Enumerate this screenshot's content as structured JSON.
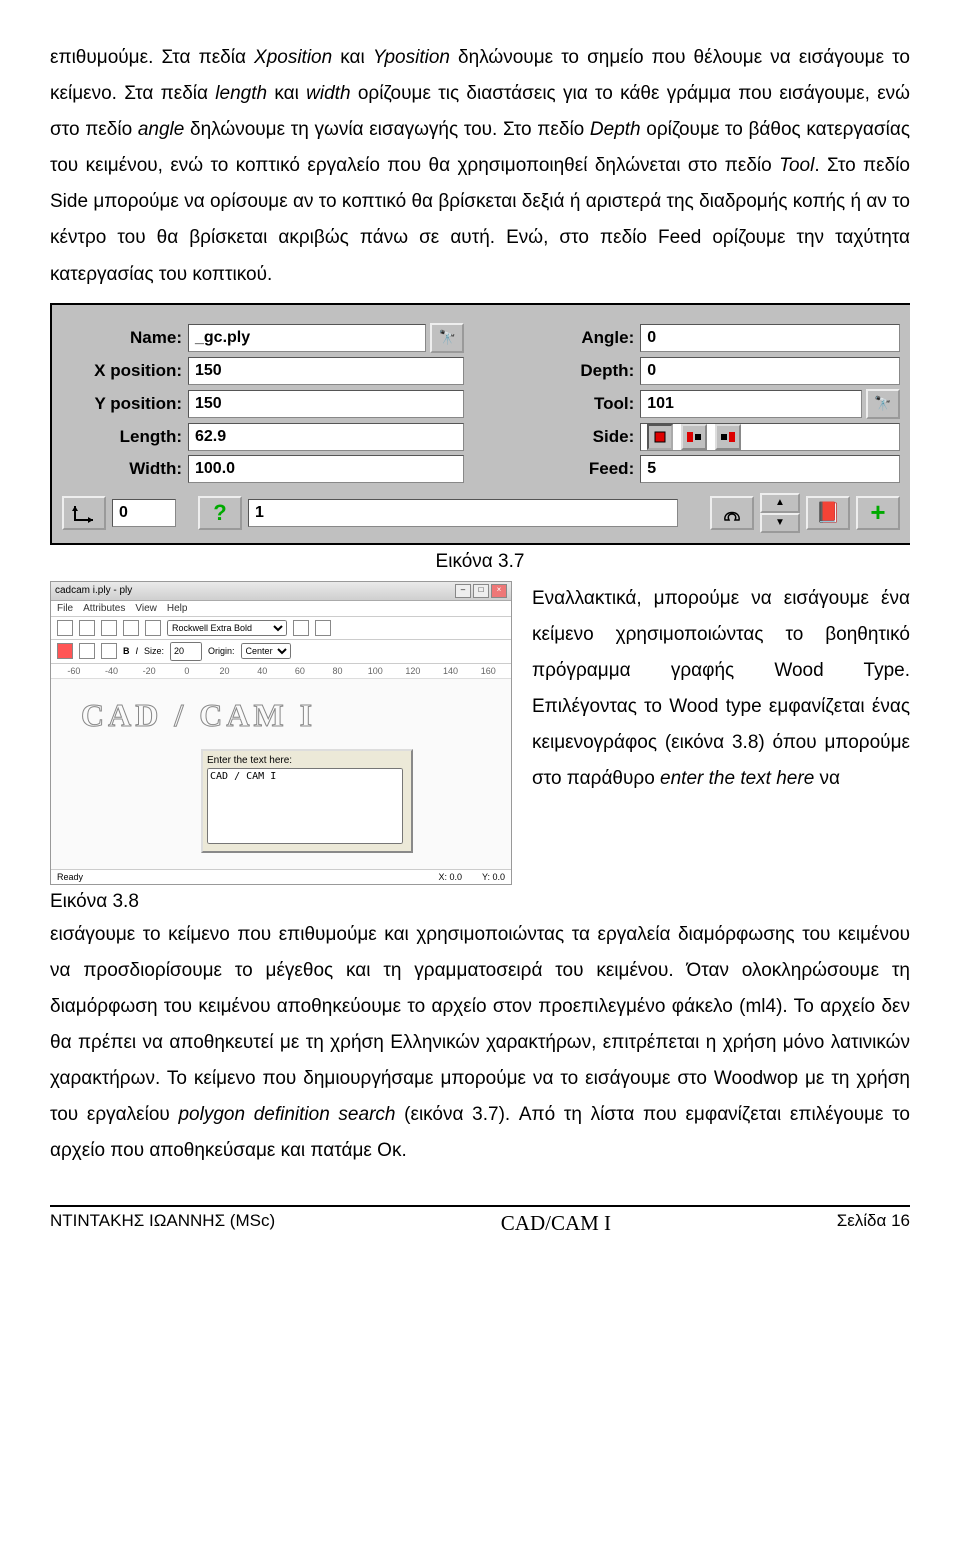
{
  "para1_a": "επιθυμούμε. Στα πεδία ",
  "para1_b": "Xposition",
  "para1_c": " και ",
  "para1_d": "Yposition",
  "para1_e": " δηλώνουμε το σημείο που θέλουμε να εισάγουμε το κείμενο. Στα πεδία ",
  "para1_f": "length",
  "para1_g": " και ",
  "para1_h": "width",
  "para1_i": " ορίζουμε τις διαστάσεις για το κάθε γράμμα που εισάγουμε, ενώ στο πεδίο ",
  "para1_j": "angle",
  "para1_k": " δηλώνουμε τη γωνία εισαγωγής του. Στο πεδίο ",
  "para1_l": "Depth",
  "para1_m": " ορίζουμε το βάθος κατεργασίας του κειμένου, ενώ το κοπτικό εργαλείο που θα χρησιμοποιηθεί δηλώνεται στο πεδίο ",
  "para1_n": "Tool",
  "para1_o": ". Στο πεδίο Side μπορούμε  να ορίσουμε αν το κοπτικό θα βρίσκεται δεξιά ή αριστερά της διαδρομής κοπής ή αν το κέντρο του θα βρίσκεται ακριβώς πάνω σε αυτή. Ενώ, στο πεδίο Feed ορίζουμε την ταχύτητα κατεργασίας του κοπτικού.",
  "dialog": {
    "labels": {
      "name": "Name:",
      "xpos": "X position:",
      "ypos": "Y position:",
      "length": "Length:",
      "width": "Width:",
      "angle": "Angle:",
      "depth": "Depth:",
      "tool": "Tool:",
      "side": "Side:",
      "feed": "Feed:"
    },
    "values": {
      "name": "_gc.ply",
      "xpos": "150",
      "ypos": "150",
      "length": "62.9",
      "width": "100.0",
      "angle": "0",
      "depth": "0",
      "tool": "101",
      "feed": "5",
      "bottom_left": "0",
      "bottom_right": "1"
    }
  },
  "caption37": "Εικόνα 3.7",
  "ss": {
    "title": "cadcam i.ply - ply",
    "menu": {
      "file": "File",
      "attributes": "Attributes",
      "view": "View",
      "help": "Help"
    },
    "toolbar2": {
      "font": "Rockwell Extra Bold",
      "b": "B",
      "i": "I",
      "size_label": "Size:",
      "size": "20",
      "origin_label": "Origin:",
      "origin": "Center"
    },
    "ruler": [
      "-60",
      "-40",
      "-20",
      "0",
      "20",
      "40",
      "60",
      "80",
      "100",
      "120",
      "140",
      "160"
    ],
    "cadcam": "CAD / CAM I",
    "enter_hdr": "Enter the text here:",
    "enter_val": "CAD / CAM I",
    "status": {
      "ready": "Ready",
      "x": "X: 0.0",
      "y": "Y: 0.0"
    }
  },
  "right1": "Εναλλακτικά, μπορούμε να εισάγουμε ένα κείμενο χρησιμοποιώντας το βοηθητικό πρόγραμμα γραφής Wood Type. Επιλέγοντας το Wood type εμφανίζεται ένας κειμενογράφος (εικόνα 3.8) όπου μπορούμε στο παράθυρο ",
  "right1_it": "enter the text here",
  "right1_b": " να",
  "caption38": "Εικόνα 3.8",
  "para2_a": "εισάγουμε το κείμενο που επιθυμούμε και χρησιμοποιώντας τα εργαλεία διαμόρφωσης του κειμένου να προσδιορίσουμε το μέγεθος και τη γραμματοσειρά του κειμένου. Όταν ολοκληρώσουμε τη διαμόρφωση του κειμένου αποθηκεύουμε το αρχείο στον προεπιλεγμένο φάκελο (ml4). Το αρχείο δεν θα πρέπει να αποθηκευτεί με τη χρήση Ελληνικών χαρακτήρων, επιτρέπεται η χρήση μόνο λατινικών χαρακτήρων. Το κείμενο που δημιουργήσαμε μπορούμε να το εισάγουμε στο Woodwop με τη χρήση του εργαλείου ",
  "para2_it": "polygon definition search",
  "para2_b": " (εικόνα 3.7). Από τη λίστα που εμφανίζεται επιλέγουμε το αρχείο που αποθηκεύσαμε και πατάμε Οκ.",
  "footer": {
    "left": "ΝΤΙΝΤΑΚΗΣ ΙΩΑΝΝΗΣ (MSc)",
    "mid": "CAD/CAM I",
    "right": "Σελίδα 16"
  }
}
